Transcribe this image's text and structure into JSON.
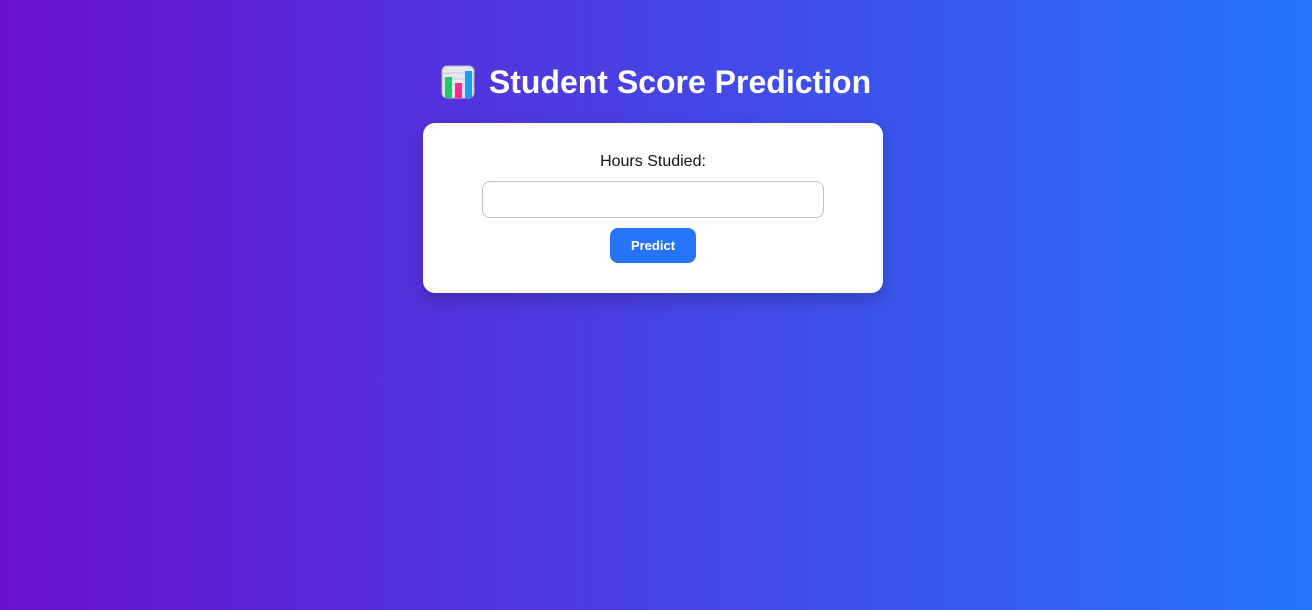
{
  "page": {
    "title": "Student Score Prediction",
    "title_icon": "bar-chart-icon",
    "background_gradient": [
      "#6a11cb",
      "#2575fc"
    ]
  },
  "form": {
    "hours_label": "Hours Studied:",
    "hours_value": "",
    "hours_placeholder": "",
    "predict_label": "Predict",
    "accent_color": "#2575fc"
  }
}
